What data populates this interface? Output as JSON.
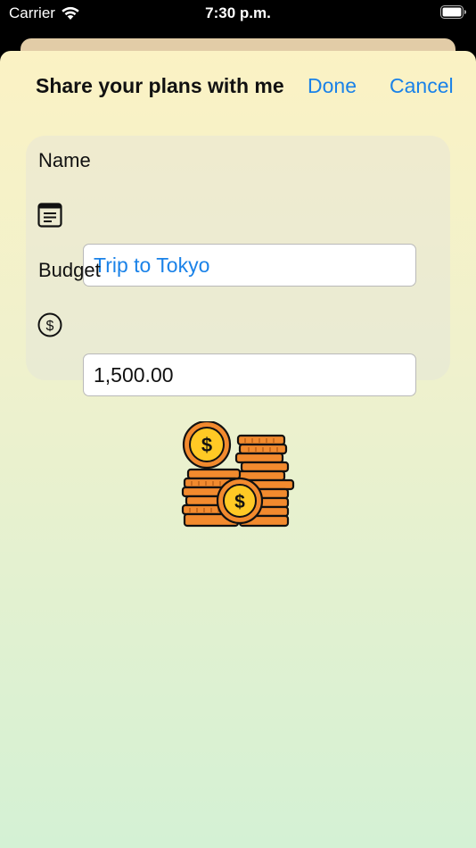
{
  "status_bar": {
    "carrier": "Carrier",
    "time": "7:30 p.m."
  },
  "nav": {
    "title": "Share your plans with me",
    "done_label": "Done",
    "cancel_label": "Cancel",
    "accent_color": "#1a82e8"
  },
  "form": {
    "name_label": "Name",
    "name_value": "Trip to Tokyo",
    "name_icon": "document-icon",
    "budget_label": "Budget",
    "budget_value": "1,500.00",
    "budget_icon": "dollar-circle-icon"
  },
  "illustration": {
    "icon": "coin-stacks-icon"
  }
}
